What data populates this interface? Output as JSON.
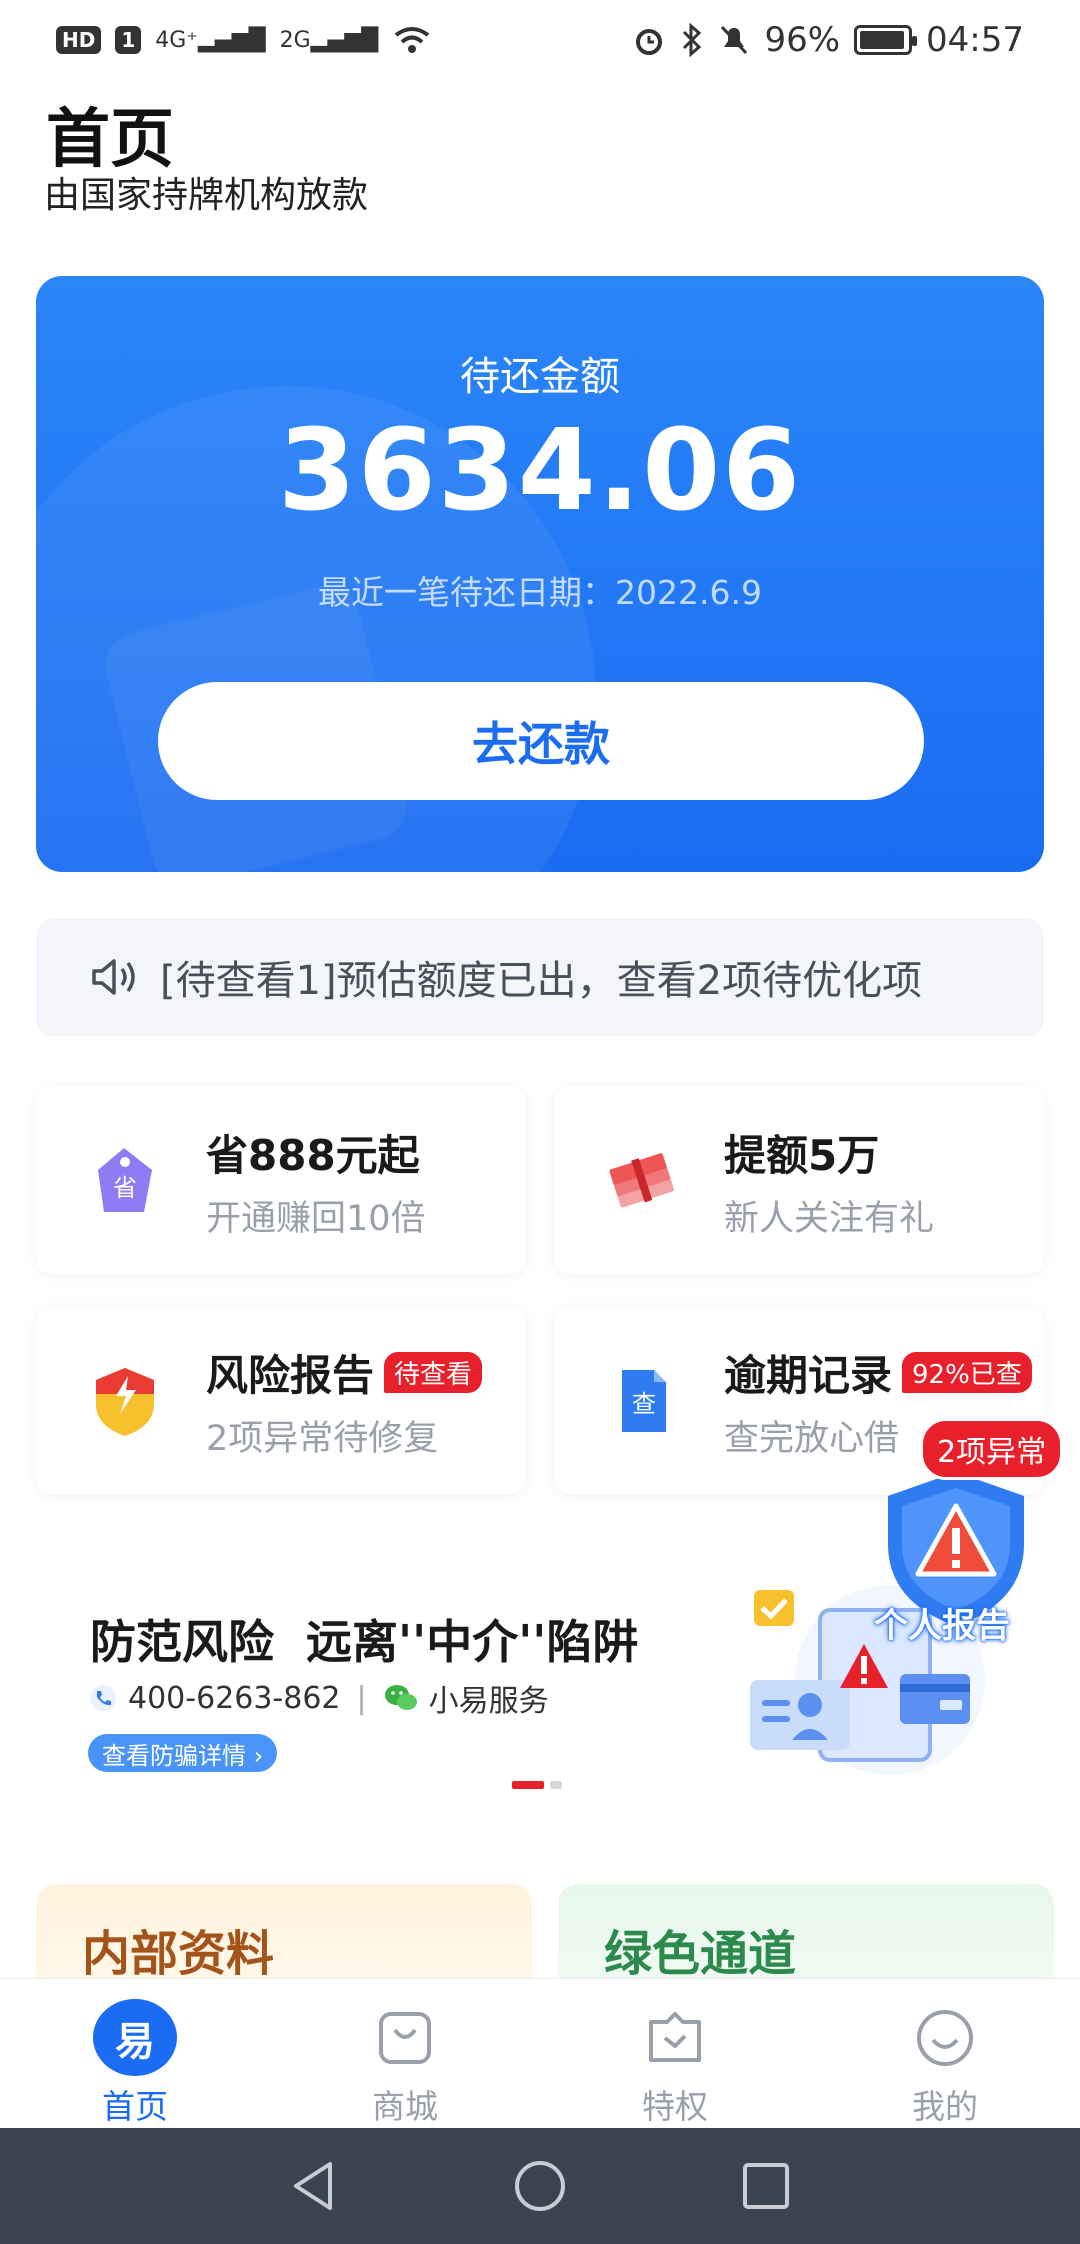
{
  "status_bar": {
    "left_chip": "HD",
    "sim": "1",
    "net1": "4G⁺",
    "net2": "2G",
    "battery_percent": "96%",
    "battery_level": 0.96,
    "time": "04:57"
  },
  "header": {
    "title": "首页",
    "subtitle": "由国家持牌机构放款"
  },
  "repay_card": {
    "label": "待还金额",
    "amount": "3634.06",
    "date_text": "最近一笔待还日期：2022.6.9",
    "button": "去还款",
    "colors": {
      "primary": "#1a6cf2",
      "top": "#2b86f8"
    }
  },
  "notice": {
    "text": "[待查看1]预估额度已出，查看2项待优化项"
  },
  "features": [
    {
      "title": "省888元起",
      "subtitle": "开通赚回10倍",
      "badge": "",
      "icon": "tag-icon"
    },
    {
      "title": "提额5万",
      "subtitle": "新人关注有礼",
      "badge": "",
      "icon": "cash-stack-icon"
    },
    {
      "title": "风险报告",
      "subtitle": "2项异常待修复",
      "badge": "待查看",
      "icon": "shield-icon"
    },
    {
      "title": "逾期记录",
      "subtitle": "查完放心借",
      "badge": "92%已查",
      "icon": "document-icon"
    }
  ],
  "float_report": {
    "bubble": "2项异常",
    "label": "个人报告"
  },
  "banner": {
    "title": "防范风险  远离''中介''陷阱",
    "phone": "400-6263-862",
    "separator": "|",
    "wechat": "小易服务",
    "button": "查看防骗详情 ›"
  },
  "promos": [
    {
      "label": "内部资料"
    },
    {
      "label": "绿色通道"
    }
  ],
  "tabbar": {
    "items": [
      {
        "label": "首页",
        "icon_text": "易",
        "active": true
      },
      {
        "label": "商城",
        "active": false
      },
      {
        "label": "特权",
        "active": false
      },
      {
        "label": "我的",
        "active": false
      }
    ]
  }
}
